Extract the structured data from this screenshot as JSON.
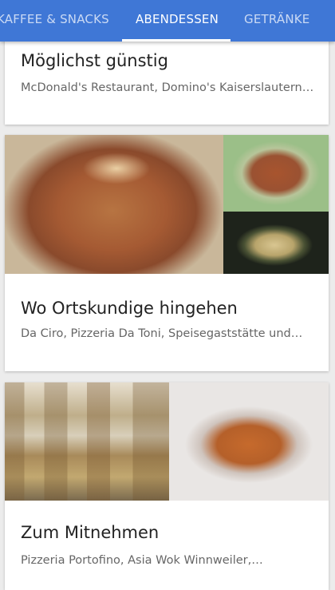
{
  "tabs": [
    {
      "label": "KAFFEE & SNACKS",
      "selected": false
    },
    {
      "label": "ABENDESSEN",
      "selected": true
    },
    {
      "label": "GETRÄNKE",
      "selected": false
    }
  ],
  "cards": [
    {
      "title": "Möglichst günstig",
      "subtitle": "McDonald's Restaurant, Domino's Kaiserslautern…"
    },
    {
      "title": "Wo Ortskundige hingehen",
      "subtitle": "Da Ciro, Pizzeria Da Toni, Speisegaststätte und…"
    },
    {
      "title": "Zum Mitnehmen",
      "subtitle": "Pizzeria Portofino, Asia Wok Winnweiler,…"
    }
  ],
  "colors": {
    "toolbar": "#3f77d6",
    "indicator": "#ffffff",
    "background": "#ececec"
  }
}
